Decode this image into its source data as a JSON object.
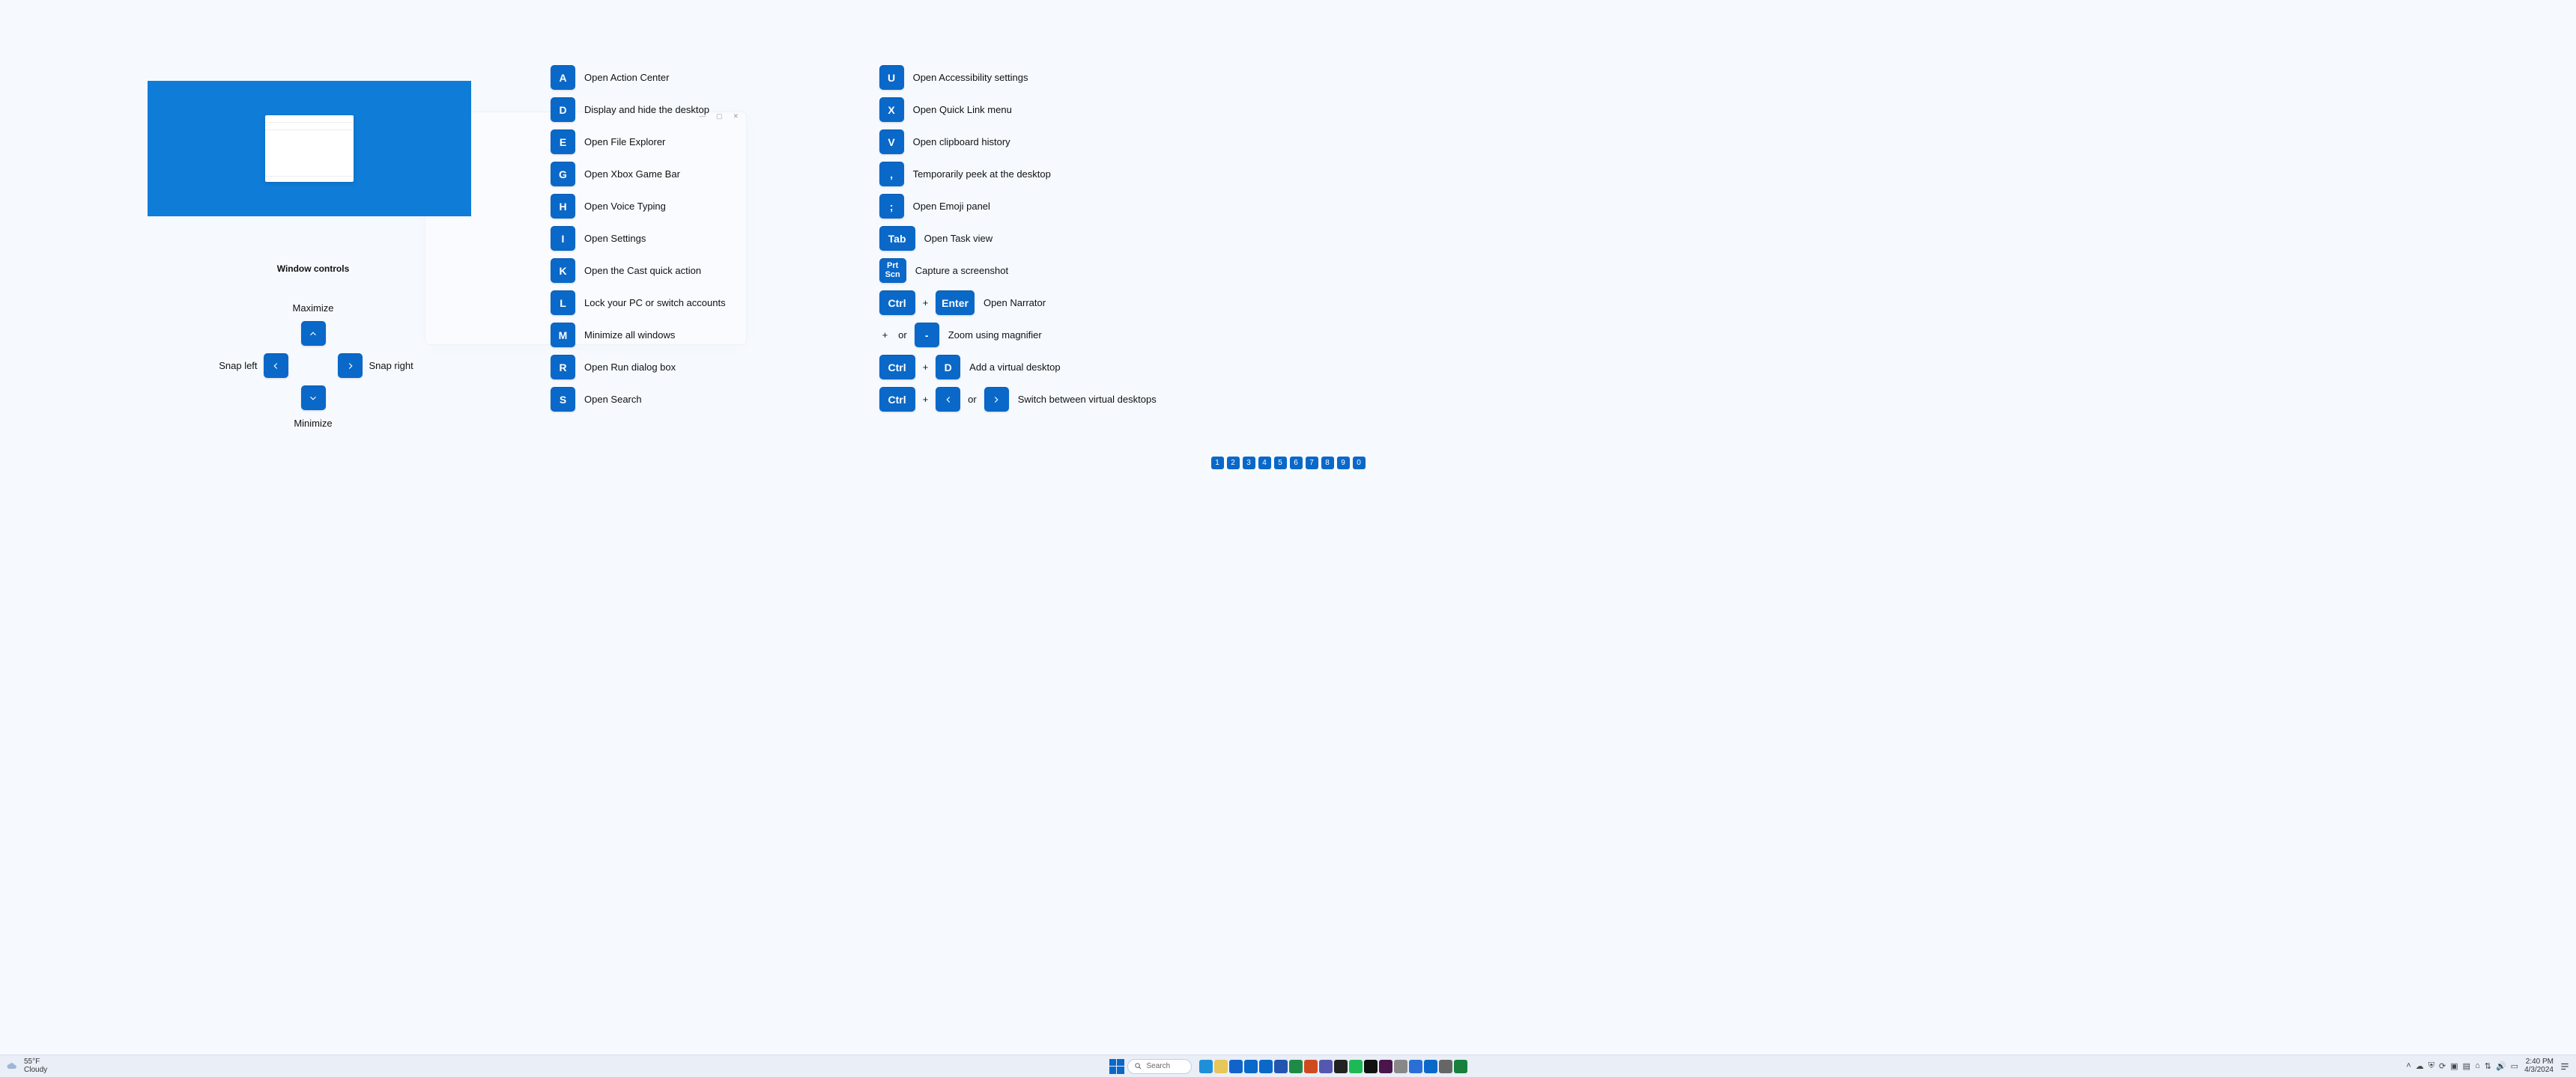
{
  "hero_window_title": "",
  "ghost": {
    "min": "—",
    "max": "▢",
    "close": "✕"
  },
  "win_controls": {
    "heading": "Window controls",
    "maximize": "Maximize",
    "minimize": "Minimize",
    "snap_left": "Snap left",
    "snap_right": "Snap right"
  },
  "shortcuts_col1": [
    {
      "key": "A",
      "desc": "Open Action Center"
    },
    {
      "key": "D",
      "desc": "Display and hide the desktop"
    },
    {
      "key": "E",
      "desc": "Open File Explorer"
    },
    {
      "key": "G",
      "desc": "Open Xbox Game Bar"
    },
    {
      "key": "H",
      "desc": "Open Voice Typing"
    },
    {
      "key": "I",
      "desc": "Open Settings"
    },
    {
      "key": "K",
      "desc": "Open the Cast quick action"
    },
    {
      "key": "L",
      "desc": "Lock your PC or switch accounts"
    },
    {
      "key": "M",
      "desc": "Minimize all windows"
    },
    {
      "key": "R",
      "desc": "Open Run dialog box"
    },
    {
      "key": "S",
      "desc": "Open Search"
    }
  ],
  "shortcuts_col2": [
    {
      "keys": [
        "U"
      ],
      "desc": "Open Accessibility settings"
    },
    {
      "keys": [
        "X"
      ],
      "desc": "Open Quick Link menu"
    },
    {
      "keys": [
        "V"
      ],
      "desc": "Open clipboard history"
    },
    {
      "keys": [
        ","
      ],
      "desc": "Temporarily peek at the desktop"
    },
    {
      "keys": [
        ";"
      ],
      "desc": "Open Emoji panel"
    },
    {
      "keys": [
        "Tab"
      ],
      "desc": "Open Task view"
    },
    {
      "keys": [
        "Prt Scn"
      ],
      "desc": "Capture a screenshot"
    },
    {
      "keys": [
        "Ctrl",
        "+",
        "Enter"
      ],
      "desc": "Open Narrator"
    },
    {
      "keys": [
        "+",
        "or",
        "-"
      ],
      "desc": "Zoom using magnifier"
    },
    {
      "keys": [
        "Ctrl",
        "+",
        "D"
      ],
      "desc": "Add a virtual desktop"
    },
    {
      "keys": [
        "Ctrl",
        "+",
        "‹",
        "or",
        "›"
      ],
      "desc": "Switch between virtual desktops"
    }
  ],
  "pages": [
    "1",
    "2",
    "3",
    "4",
    "5",
    "6",
    "7",
    "8",
    "9",
    "0"
  ],
  "taskbar": {
    "weather_temp": "55°F",
    "weather_cond": "Cloudy",
    "search_placeholder": "Search",
    "clock_time": "2:40 PM",
    "clock_date": "4/3/2024",
    "apps": [
      {
        "name": "edge",
        "color": "#1e8fd8"
      },
      {
        "name": "explorer",
        "color": "#e7c65a"
      },
      {
        "name": "store",
        "color": "#1163c9"
      },
      {
        "name": "mail",
        "color": "#0a68c8"
      },
      {
        "name": "outlook",
        "color": "#0a68c8"
      },
      {
        "name": "word",
        "color": "#2155b0"
      },
      {
        "name": "excel",
        "color": "#1f8a46"
      },
      {
        "name": "power",
        "color": "#cf4b1f"
      },
      {
        "name": "teams",
        "color": "#5558af"
      },
      {
        "name": "terminal",
        "color": "#222"
      },
      {
        "name": "spotify",
        "color": "#1db954"
      },
      {
        "name": "figma",
        "color": "#111"
      },
      {
        "name": "slack",
        "color": "#4a154b"
      },
      {
        "name": "app1",
        "color": "#888"
      },
      {
        "name": "app2",
        "color": "#2a6fd6"
      },
      {
        "name": "vscode",
        "color": "#0a68c8"
      },
      {
        "name": "settings",
        "color": "#666"
      },
      {
        "name": "app3",
        "color": "#17803d"
      }
    ],
    "tray": [
      {
        "name": "chevron",
        "glyph": "˄"
      },
      {
        "name": "onedrive",
        "glyph": "☁"
      },
      {
        "name": "shield",
        "glyph": "⛨"
      },
      {
        "name": "sync",
        "glyph": "⟳"
      },
      {
        "name": "tb1",
        "glyph": "▣"
      },
      {
        "name": "tb2",
        "glyph": "▤"
      },
      {
        "name": "tb3",
        "glyph": "⌂"
      },
      {
        "name": "wifi",
        "glyph": "⇅"
      },
      {
        "name": "volume",
        "glyph": "🔊"
      },
      {
        "name": "battery",
        "glyph": "▭"
      }
    ]
  }
}
